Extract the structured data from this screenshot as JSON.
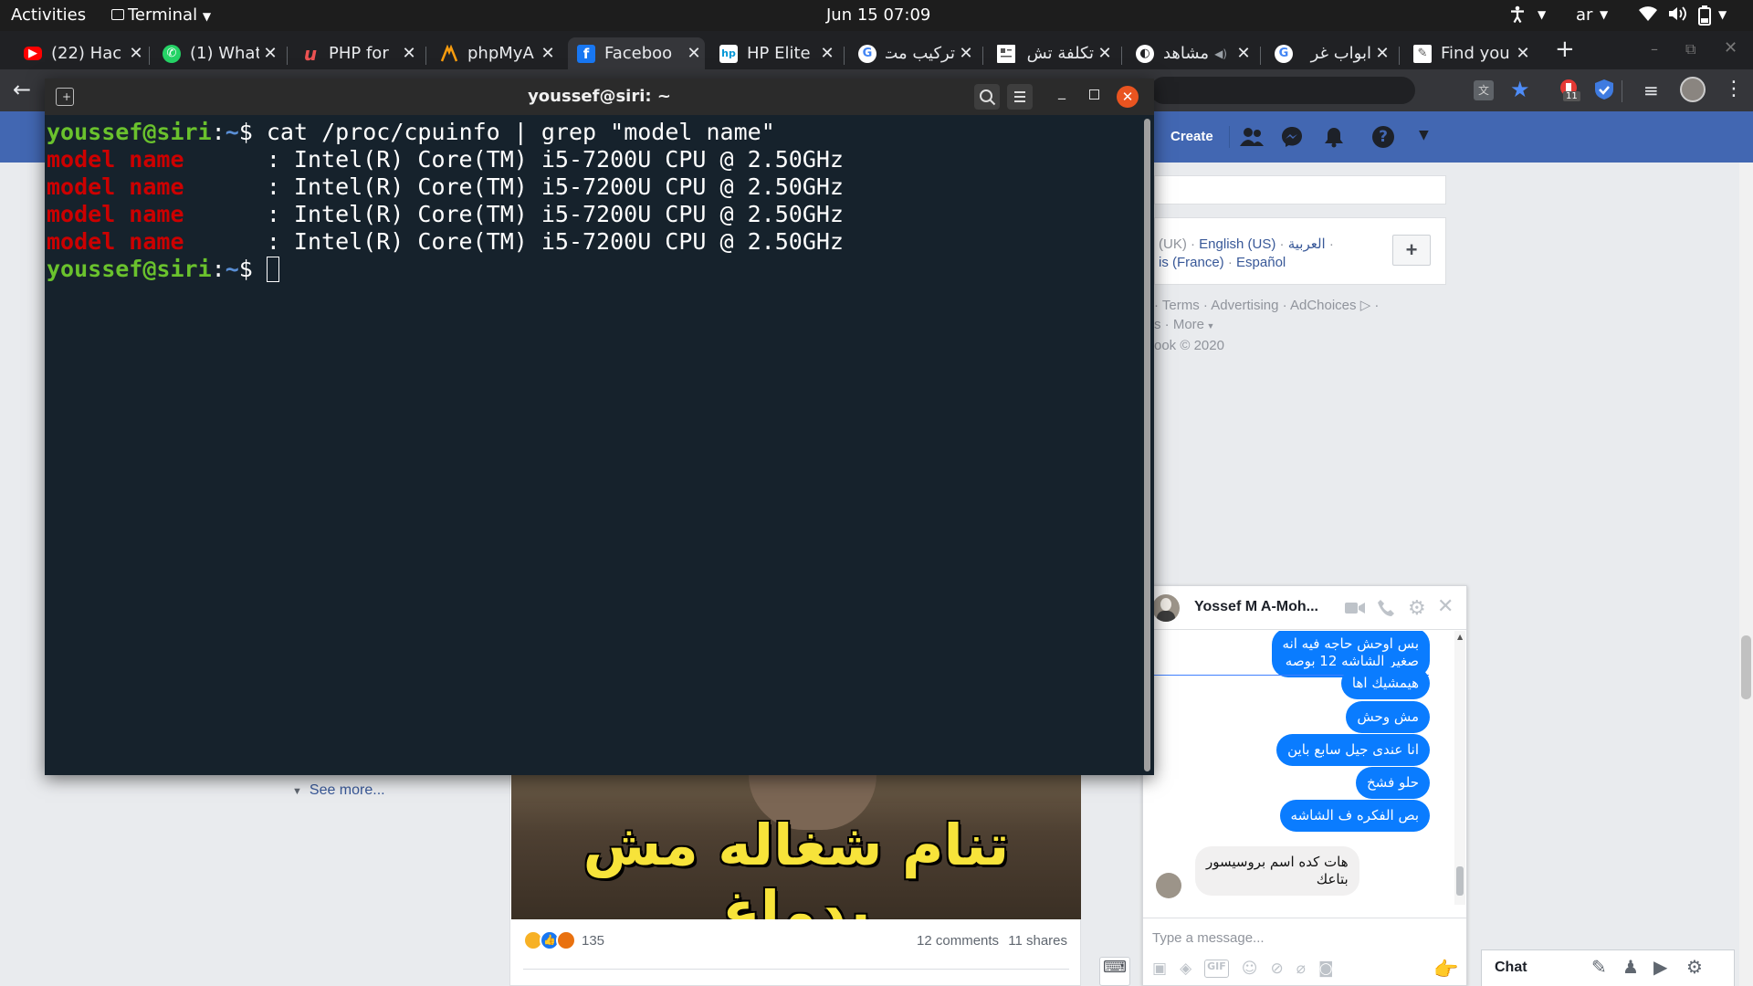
{
  "topbar": {
    "activities": "Activities",
    "app_menu": "Terminal",
    "clock": "Jun 15  07:09",
    "lang": "ar"
  },
  "tabs": [
    {
      "label": "(22) Hac",
      "icon": "youtube-icon",
      "color": "#ff0000"
    },
    {
      "label": "(1) What",
      "icon": "whatsapp-icon",
      "color": "#25d366"
    },
    {
      "label": "PHP for",
      "icon": "udemy-icon",
      "color": "#ec5252"
    },
    {
      "label": "phpMyA",
      "icon": "phpmyadmin-icon",
      "color": "#f89c0e"
    },
    {
      "label": "Faceboo",
      "icon": "facebook-icon",
      "color": "#1877f2"
    },
    {
      "label": "HP Elite",
      "icon": "hp-icon",
      "color": "#0096d6"
    },
    {
      "label": "تركيب مت",
      "icon": "google-icon",
      "color": "#4285f4"
    },
    {
      "label": "تكلفة تش",
      "icon": "page-icon",
      "color": "#ffffff"
    },
    {
      "label": "مشاهد",
      "icon": "globe-icon",
      "color": "#ffffff"
    },
    {
      "label": "ابواب غر",
      "icon": "google-icon",
      "color": "#4285f4"
    },
    {
      "label": "Find you",
      "icon": "document-icon",
      "color": "#ffffff"
    }
  ],
  "toolbar": {
    "extension_badge": "11"
  },
  "terminal": {
    "title": "youssef@siri: ~",
    "prompt_user": "youssef@siri",
    "prompt_sep": ":",
    "prompt_path": "~",
    "prompt_sign": "$ ",
    "command": "cat /proc/cpuinfo | grep \"model name\"",
    "output": [
      {
        "key": "model name",
        "value": "      : Intel(R) Core(TM) i5-7200U CPU @ 2.50GHz"
      },
      {
        "key": "model name",
        "value": "      : Intel(R) Core(TM) i5-7200U CPU @ 2.50GHz"
      },
      {
        "key": "model name",
        "value": "      : Intel(R) Core(TM) i5-7200U CPU @ 2.50GHz"
      },
      {
        "key": "model name",
        "value": "      : Intel(R) Core(TM) i5-7200U CPU @ 2.50GHz"
      }
    ]
  },
  "facebook": {
    "create": "Create",
    "languages": {
      "uk": "(UK)",
      "en_us": "English (US)",
      "ar": "العربية",
      "fr": "is (France)",
      "es": "Español",
      "add": "+"
    },
    "footer": {
      "terms": "Terms",
      "advertising": "Advertising",
      "adchoices": "AdChoices",
      "s": "s",
      "more": "More",
      "copyright": "ook © 2020"
    },
    "see_more": "See more...",
    "post": {
      "meme_caption": "تنام شغاله مش بدماغ",
      "reactions_count": "135",
      "comments": "12 comments",
      "shares": "11 shares"
    }
  },
  "chat": {
    "name": "Yossef M A-Moh...",
    "messages_out": [
      "بس اوحش حاجه فيه انه\nصغير الشاشه 12 بوصه",
      "هيمشيك اها",
      "مش وحش",
      "انا عندى جيل سابع باين",
      "حلو فشخ",
      "بص الفكره ف الشاشه"
    ],
    "message_in": "هات كده اسم بروسيسور\nبتاعك",
    "input_placeholder": "Type a message...",
    "chat_bar_label": "Chat"
  }
}
